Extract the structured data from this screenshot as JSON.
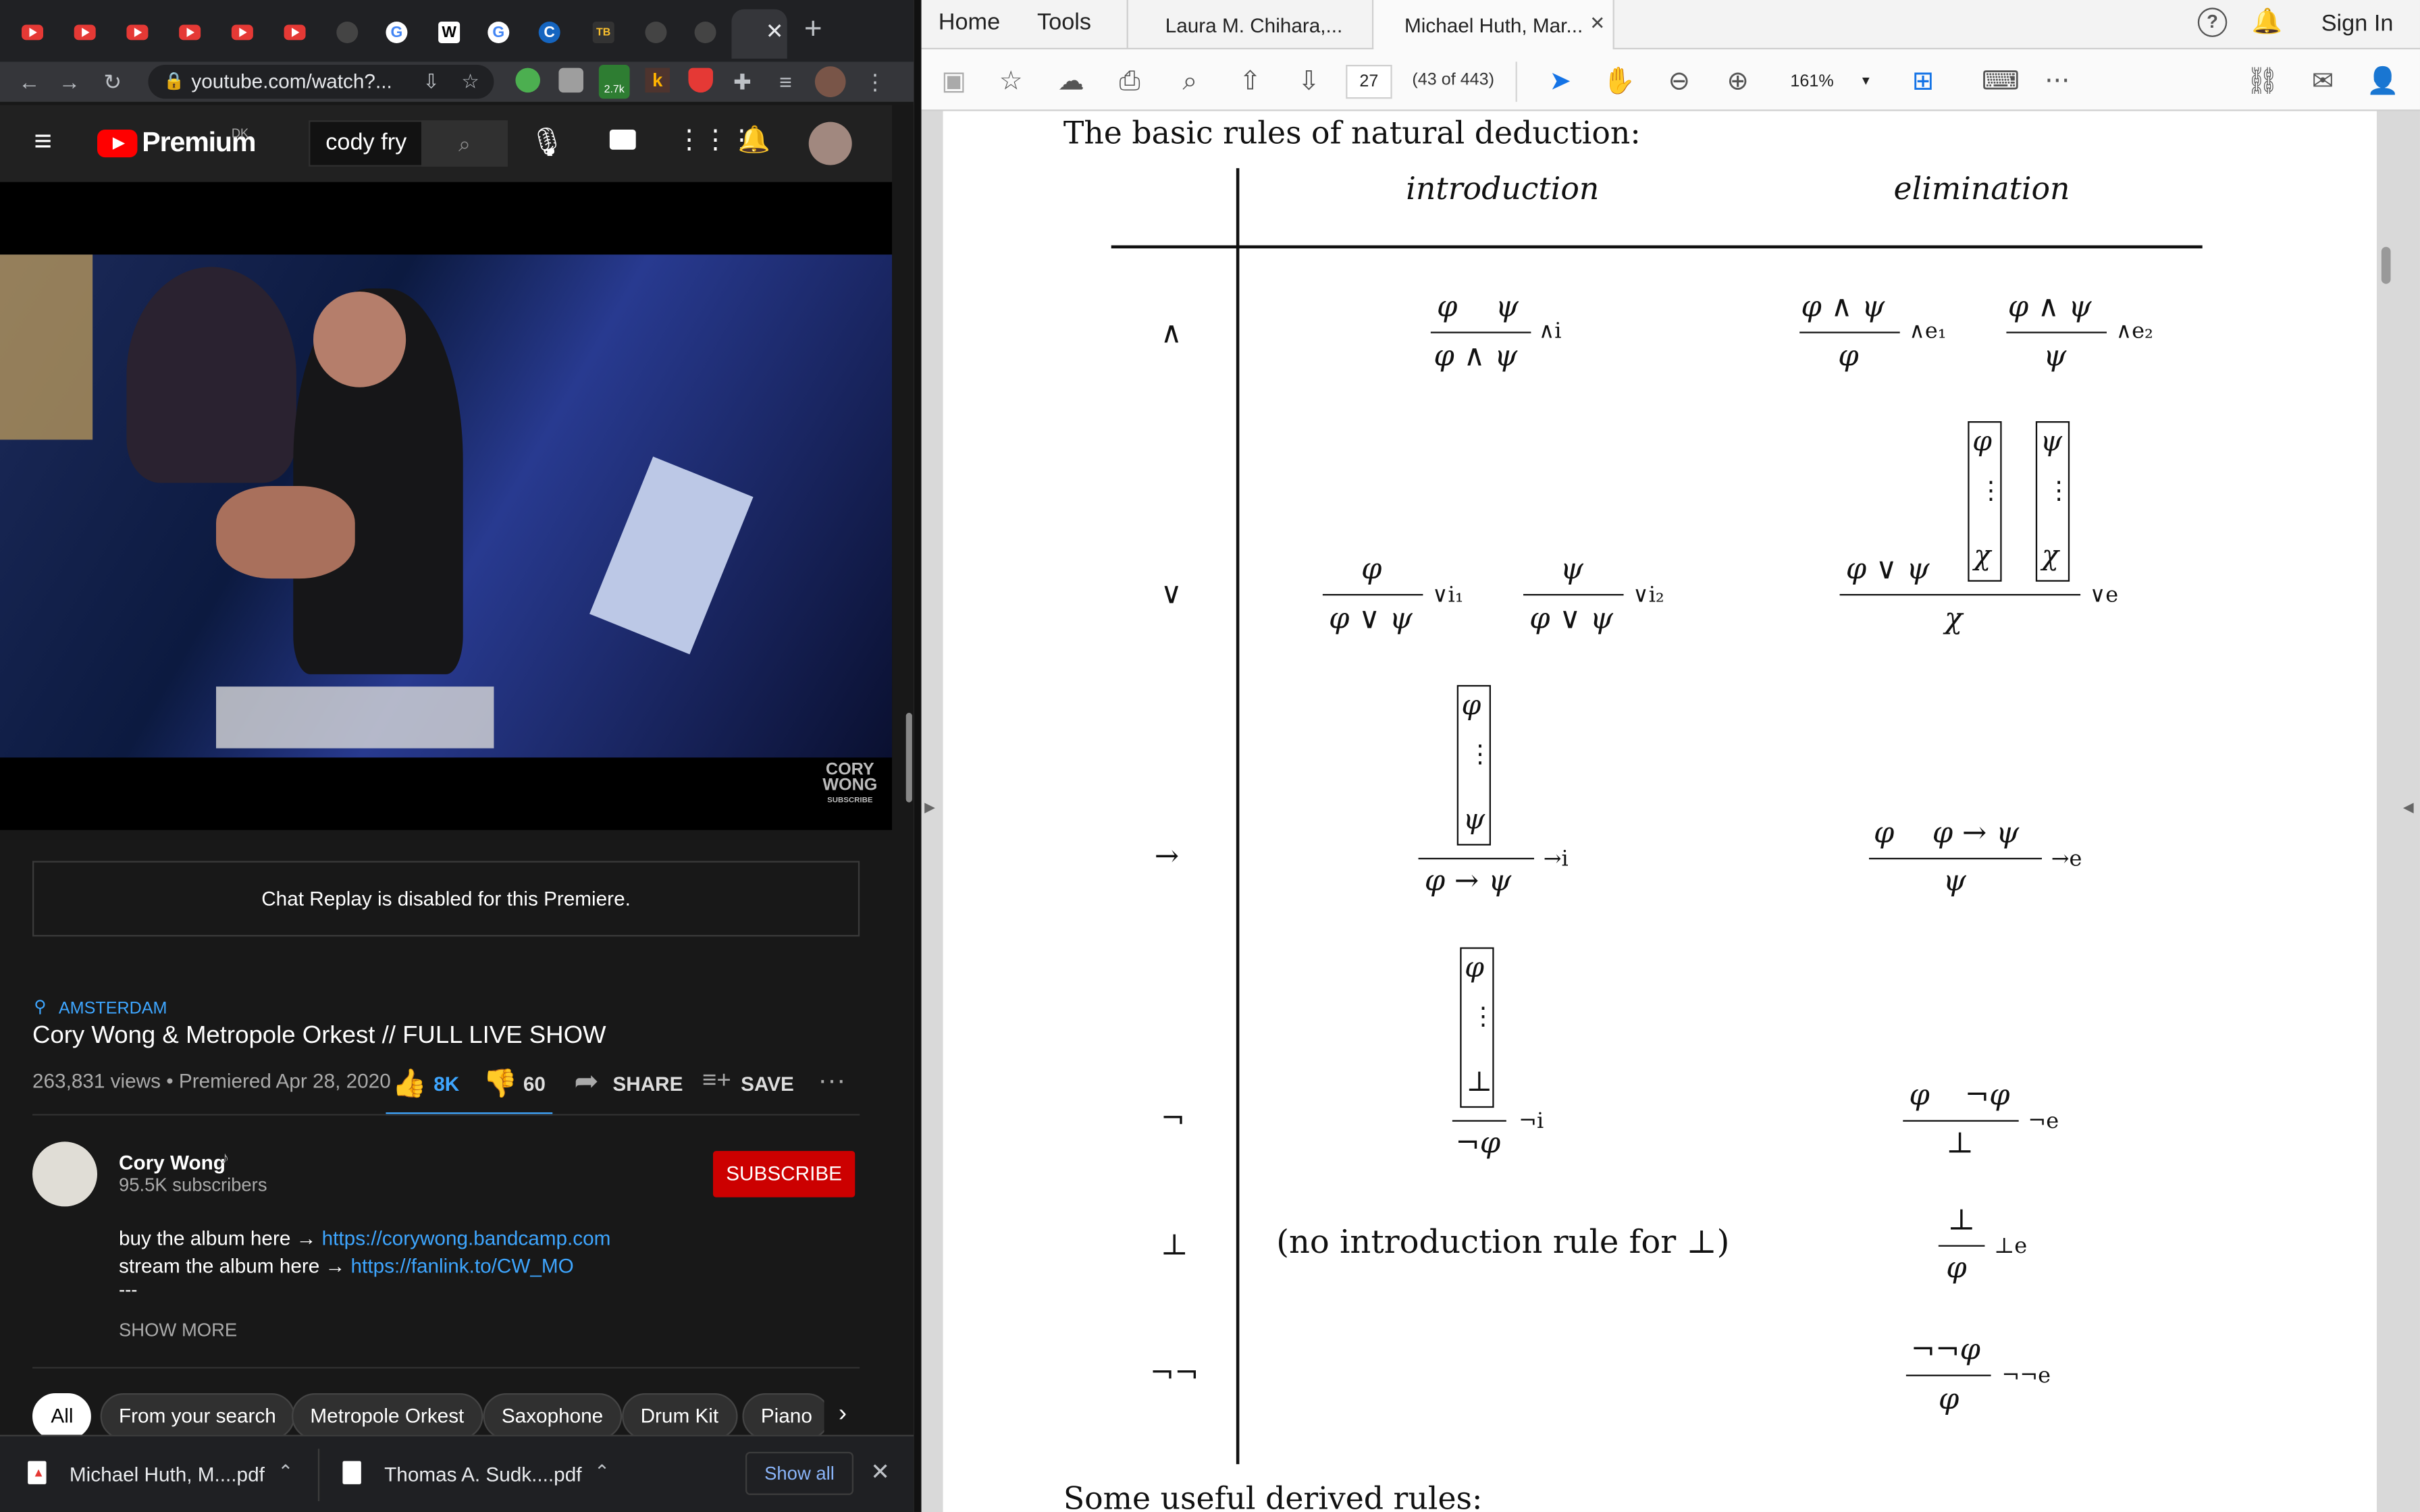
{
  "browser": {
    "url": "youtube.com/watch?...",
    "ext_badge": "2.7k",
    "ext_letter": "k"
  },
  "youtube": {
    "logo": "Premium",
    "region": "DK",
    "search_value": "cody fry",
    "chat_replay": "Chat Replay is disabled for this Premiere.",
    "location": "AMSTERDAM",
    "title": "Cory Wong & Metropole Orkest // FULL LIVE SHOW",
    "views": "263,831 views • Premiered Apr 28, 2020",
    "likes": "8K",
    "dislikes": "60",
    "share": "SHARE",
    "save": "SAVE",
    "channel": "Cory Wong",
    "subscribers": "95.5K subscribers",
    "subscribe": "SUBSCRIBE",
    "desc1_prefix": "buy the album here → ",
    "desc1_link": "https://corywong.bandcamp.com",
    "desc2_prefix": "stream the album here → ",
    "desc2_link": "https://fanlink.to/CW_MO",
    "desc3": "---",
    "show_more": "SHOW MORE",
    "watermark1": "CORY",
    "watermark2": "WONG",
    "watermark3": "SUBSCRIBE",
    "chips": [
      "All",
      "From your search",
      "Metropole Orkest",
      "Saxophone",
      "Drum Kit",
      "Piano"
    ]
  },
  "downloads": {
    "file1": "Michael Huth, M....pdf",
    "file2": "Thomas A. Sudk....pdf",
    "show_all": "Show all"
  },
  "acrobat": {
    "home": "Home",
    "tools": "Tools",
    "doc_tab1": "Laura M. Chihara,...",
    "doc_tab2": "Michael Huth, Mar...",
    "sign_in": "Sign In",
    "page_number": "27",
    "page_of": "(43 of 443)",
    "zoom": "161%"
  },
  "doc": {
    "heading": "The basic rules of natural deduction:",
    "col_intro": "introduction",
    "col_elim": "elimination",
    "rows": [
      "∧",
      "∨",
      "→",
      "¬",
      "⊥",
      "¬¬"
    ],
    "and_i_top_a": "φ",
    "and_i_top_b": "ψ",
    "and_i_bottom": "φ ∧ ψ",
    "and_i_label": "∧i",
    "and_e1_top": "φ ∧ ψ",
    "and_e1_bottom": "φ",
    "and_e1_label": "∧e₁",
    "and_e2_top": "φ ∧ ψ",
    "and_e2_bottom": "ψ",
    "and_e2_label": "∧e₂",
    "or_i1_top": "φ",
    "or_i1_bottom": "φ ∨ ψ",
    "or_i1_label": "∨i₁",
    "or_i2_top": "ψ",
    "or_i2_bottom": "φ ∨ ψ",
    "or_i2_label": "∨i₂",
    "or_e_premise": "φ ∨ ψ",
    "or_e_box1_top": "φ",
    "or_e_box1_bottom": "χ",
    "or_e_box2_top": "ψ",
    "or_e_box2_bottom": "χ",
    "or_e_bottom": "χ",
    "or_e_label": "∨e",
    "vdots": "⋮",
    "imp_i_box_top": "φ",
    "imp_i_box_bottom": "ψ",
    "imp_i_bottom": "φ → ψ",
    "imp_i_label": "→i",
    "imp_e_top_a": "φ",
    "imp_e_top_b": "φ → ψ",
    "imp_e_bottom": "ψ",
    "imp_e_label": "→e",
    "neg_i_box_top": "φ",
    "neg_i_box_bottom": "⊥",
    "neg_i_bottom": "¬φ",
    "neg_i_label": "¬i",
    "neg_e_top_a": "φ",
    "neg_e_top_b": "¬φ",
    "neg_e_bottom": "⊥",
    "neg_e_label": "¬e",
    "bot_intro_text": "(no introduction rule for ⊥)",
    "bot_e_top": "⊥",
    "bot_e_bottom": "φ",
    "bot_e_label": "⊥e",
    "dneg_e_top": "¬¬φ",
    "dneg_e_bottom": "φ",
    "dneg_e_label": "¬¬e",
    "footer": "Some useful derived rules:"
  }
}
